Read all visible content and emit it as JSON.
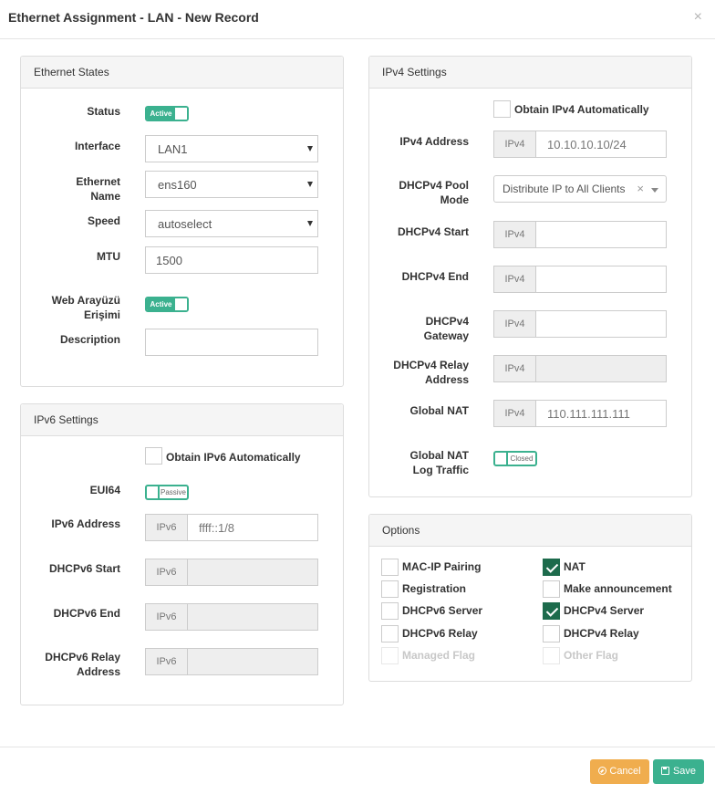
{
  "modal": {
    "title": "Ethernet Assignment - LAN - New Record",
    "close_glyph": "×"
  },
  "ethernet_states": {
    "heading": "Ethernet States",
    "status_label": "Status",
    "status_toggle": "Active",
    "interface_label": "Interface",
    "interface_value": "LAN1",
    "ethernet_name_label_1": "Ethernet",
    "ethernet_name_label_2": "Name",
    "ethernet_name_value": "ens160",
    "speed_label": "Speed",
    "speed_value": "autoselect",
    "mtu_label": "MTU",
    "mtu_value": "1500",
    "web_label_1": "Web Arayüzü",
    "web_label_2": "Erişimi",
    "web_toggle": "Active",
    "description_label": "Description",
    "description_value": ""
  },
  "ipv6": {
    "heading": "IPv6 Settings",
    "obtain_label": "Obtain IPv6 Automatically",
    "obtain_checked": false,
    "eui64_label": "EUI64",
    "eui64_toggle": "Passive",
    "address_label": "IPv6 Address",
    "addon": "IPv6",
    "address_value": "ffff::1/8",
    "dhcp_start_label": "DHCPv6 Start",
    "dhcp_end_label": "DHCPv6 End",
    "relay_label_1": "DHCPv6 Relay",
    "relay_label_2": "Address"
  },
  "ipv4": {
    "heading": "IPv4 Settings",
    "obtain_label": "Obtain IPv4 Automatically",
    "obtain_checked": false,
    "address_label": "IPv4 Address",
    "addon": "IPv4",
    "address_value": "10.10.10.10/24",
    "pool_label_1": "DHCPv4 Pool",
    "pool_label_2": "Mode",
    "pool_value": "Distribute IP to All Clients",
    "pool_clear": "×",
    "start_label": "DHCPv4 Start",
    "end_label": "DHCPv4 End",
    "gateway_label_1": "DHCPv4",
    "gateway_label_2": "Gateway",
    "relay_label_1": "DHCPv4 Relay",
    "relay_label_2": "Address",
    "nat_label": "Global NAT",
    "nat_value": "110.111.111.111",
    "nat_log_label_1": "Global NAT",
    "nat_log_label_2": "Log Traffic",
    "nat_log_toggle": "Closed"
  },
  "options": {
    "heading": "Options",
    "items": [
      {
        "label": "MAC-IP Pairing",
        "checked": false,
        "disabled": false
      },
      {
        "label": "NAT",
        "checked": true,
        "disabled": false
      },
      {
        "label": "Registration",
        "checked": false,
        "disabled": false
      },
      {
        "label": "Make announcement",
        "checked": false,
        "disabled": false
      },
      {
        "label": "DHCPv6 Server",
        "checked": false,
        "disabled": false
      },
      {
        "label": "DHCPv4 Server",
        "checked": true,
        "disabled": false
      },
      {
        "label": "DHCPv6 Relay",
        "checked": false,
        "disabled": false
      },
      {
        "label": "DHCPv4 Relay",
        "checked": false,
        "disabled": false
      },
      {
        "label": "Managed Flag",
        "checked": false,
        "disabled": true
      },
      {
        "label": "Other Flag",
        "checked": false,
        "disabled": true
      }
    ]
  },
  "footer": {
    "cancel_label": "Cancel",
    "save_label": "Save"
  },
  "colors": {
    "accent": "#3bb18f",
    "checked": "#1d6b4c",
    "cancel": "#f0ad4e"
  }
}
